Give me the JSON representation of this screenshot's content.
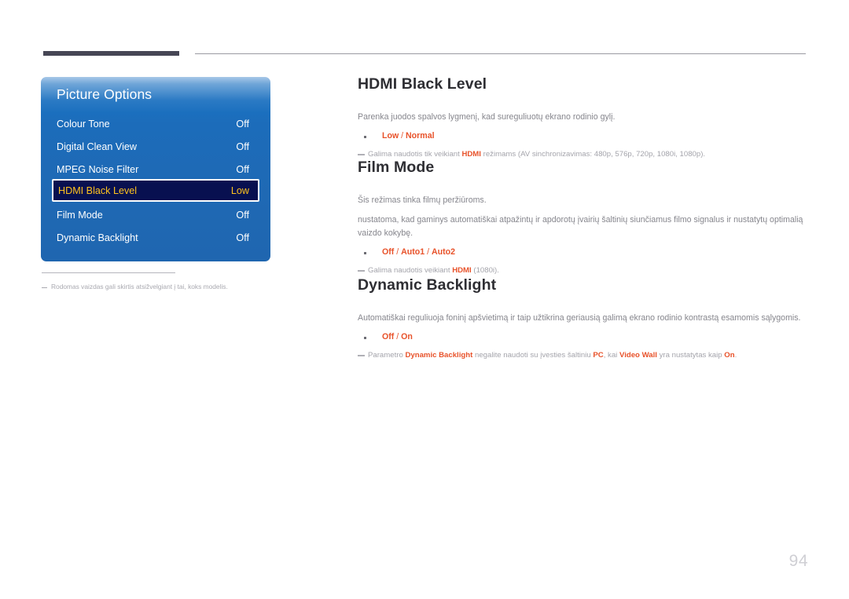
{
  "page": {
    "number": "94"
  },
  "osd": {
    "title": "Picture Options",
    "rows": [
      {
        "label": "Colour Tone",
        "value": "Off",
        "selected": false
      },
      {
        "label": "Digital Clean View",
        "value": "Off",
        "selected": false
      },
      {
        "label": "MPEG Noise Filter",
        "value": "Off",
        "selected": false
      },
      {
        "label": "HDMI Black Level",
        "value": "Low",
        "selected": true
      },
      {
        "label": "Film Mode",
        "value": "Off",
        "selected": false
      },
      {
        "label": "Dynamic Backlight",
        "value": "Off",
        "selected": false
      }
    ],
    "footnote": "Rodomas vaizdas gali skirtis atsižvelgiant į tai, koks modelis."
  },
  "sections": {
    "hdmi_black_level": {
      "title": "HDMI Black Level",
      "para": "Parenka juodos spalvos lygmenį, kad sureguliuotų ekrano rodinio gylį.",
      "options_a": "Low",
      "options_sep": " / ",
      "options_b": "Normal",
      "note_pre": "Galima naudotis tik veikiant ",
      "note_bold": "HDMI",
      "note_post": " režimams (AV sinchronizavimas: 480p, 576p, 720p, 1080i, 1080p)."
    },
    "film_mode": {
      "title": "Film Mode",
      "para1": "Šis režimas tinka filmų peržiūroms.",
      "para2": "nustatoma, kad gaminys automatiškai atpažintų ir apdorotų įvairių šaltinių siunčiamus filmo signalus ir nustatytų optimalią vaizdo kokybę.",
      "option1": "Off",
      "option2": "Auto1",
      "option3": "Auto2",
      "options_sep": " / ",
      "note_pre": "Galima naudotis veikiant ",
      "note_bold": "HDMI",
      "note_post": " (1080i)."
    },
    "dynamic_backlight": {
      "title": "Dynamic Backlight",
      "para": "Automatiškai reguliuoja foninį apšvietimą ir taip užtikrina geriausią galimą ekrano rodinio kontrastą esamomis sąlygomis.",
      "option1": "Off",
      "option2": "On",
      "options_sep": " / ",
      "note_1": "Parametro ",
      "note_b1": "Dynamic Backlight",
      "note_2": " negalite naudoti su įvesties šaltiniu ",
      "note_b2": "PC",
      "note_3": ", kai ",
      "note_b3": "Video Wall",
      "note_4": " yra nustatytas kaip ",
      "note_b4": "On",
      "note_5": "."
    }
  },
  "colors": {
    "accent_orange": "#e8522a",
    "osd_blue": "#1f69b4",
    "osd_highlight_bg": "#081050",
    "osd_highlight_text": "#ffc31e",
    "rule_dark": "#464655",
    "body_text": "#86868d",
    "heading_text": "#2e2e33"
  }
}
